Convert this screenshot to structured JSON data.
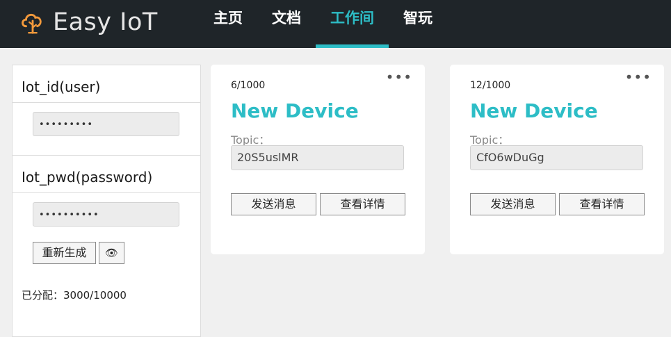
{
  "header": {
    "app_name": "Easy IoT",
    "nav": [
      {
        "label": "主页",
        "active": false
      },
      {
        "label": "文档",
        "active": false
      },
      {
        "label": "工作间",
        "active": true
      },
      {
        "label": "智玩",
        "active": false
      }
    ],
    "accent_color": "#2dbdc6"
  },
  "credentials": {
    "user_label": "Iot_id(user)",
    "user_value": "•••••••••",
    "pwd_label": "Iot_pwd(password)",
    "pwd_value": "••••••••••",
    "regenerate_label": "重新生成",
    "reveal_icon": "eye-icon",
    "reveal_glyph": "👁",
    "allocated_text": "已分配：3000/10000"
  },
  "devices": [
    {
      "counter": "6/1000",
      "name": "New Device",
      "topic_label": "Topic：",
      "topic_value": "20S5uslMR",
      "send_label": "发送消息",
      "detail_label": "查看详情",
      "more_icon": "•••"
    },
    {
      "counter": "12/1000",
      "name": "New Device",
      "topic_label": "Topic：",
      "topic_value": "CfO6wDuGg",
      "send_label": "发送消息",
      "detail_label": "查看详情",
      "more_icon": "•••"
    }
  ]
}
